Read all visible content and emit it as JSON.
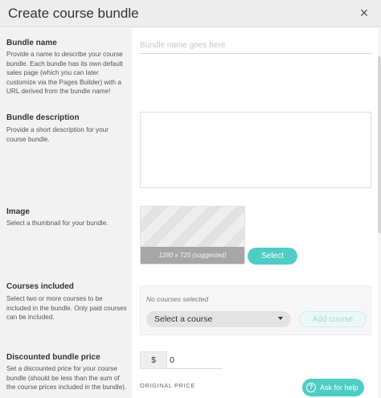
{
  "header": {
    "title": "Create course bundle",
    "close_icon": "×"
  },
  "bundle_name": {
    "label": "Bundle name",
    "description": "Provide a name to describe your course bundle. Each bundle has its own default sales page (which you can later customize via the Pages Builder) with a URL derived from the bundle name!",
    "value": "",
    "placeholder": "Bundle name goes here"
  },
  "bundle_description": {
    "label": "Bundle description",
    "description": "Provide a short description for your course bundle.",
    "value": ""
  },
  "image": {
    "label": "Image",
    "description": "Select a thumbnail for your bundle.",
    "thumbnail_caption": "1280 x 720 (suggested)",
    "select_label": "Select"
  },
  "courses": {
    "label": "Courses included",
    "description": "Select two or more courses to be included in the bundle. Only paid courses can be included.",
    "empty_text": "No courses selected",
    "select_value": "Select a course",
    "add_label": "Add course"
  },
  "price": {
    "label": "Discounted bundle price",
    "description": "Set a discounted price for your course bundle (should be less than the sum of the course prices included in the bundle).",
    "currency": "$",
    "value": "0",
    "original_label": "ORIGINAL PRICE"
  },
  "help": {
    "label": "Ask for help",
    "icon": "?"
  },
  "colors": {
    "accent": "#4ecdc4",
    "sidebar": "#f2f2f2",
    "header": "#ededed"
  }
}
